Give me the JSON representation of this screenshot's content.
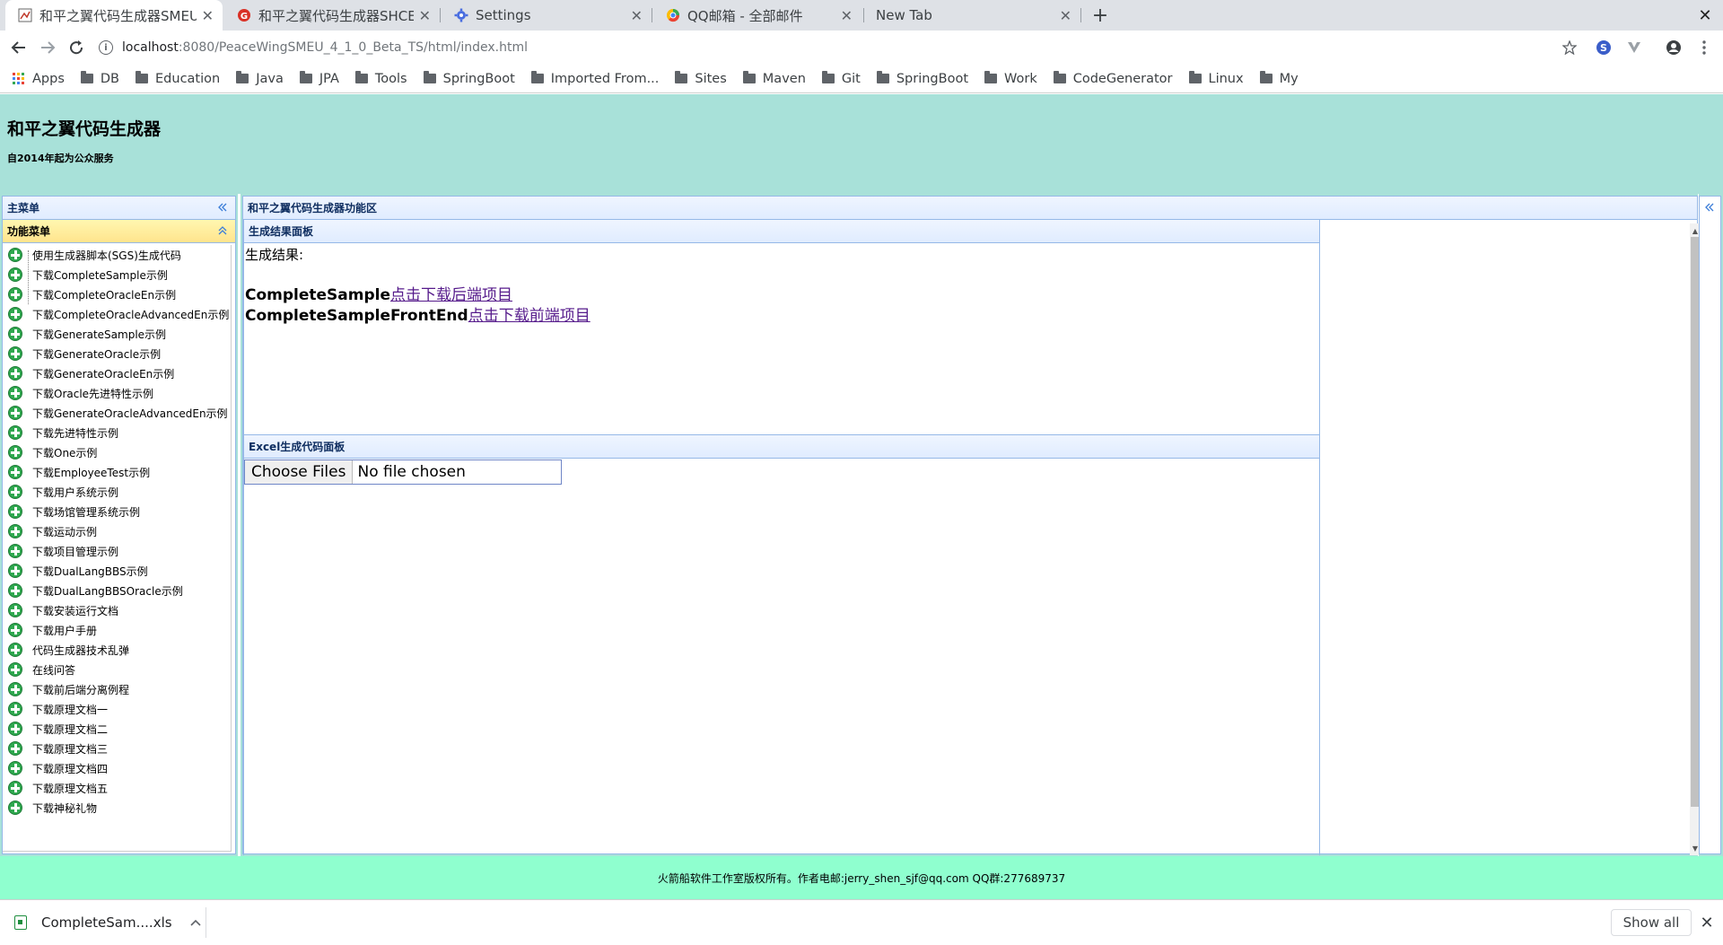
{
  "browser": {
    "tabs": [
      {
        "title": "和平之翼代码生成器SMEU",
        "active": true
      },
      {
        "title": "和平之翼代码生成器SHCE",
        "active": false
      },
      {
        "title": "Settings",
        "active": false
      },
      {
        "title": "QQ邮箱 - 全部邮件",
        "active": false
      },
      {
        "title": "New Tab",
        "active": false
      }
    ],
    "new_tab_label": "+",
    "close_label": "✕",
    "address": {
      "host": "localhost",
      "path": ":8080/PeaceWingSMEU_4_1_0_Beta_TS/html/index.html"
    },
    "bookmarks": [
      "Apps",
      "DB",
      "Education",
      "Java",
      "JPA",
      "Tools",
      "SpringBoot",
      "Imported From...",
      "Sites",
      "Maven",
      "Git",
      "SpringBoot",
      "Work",
      "CodeGenerator",
      "Linux",
      "My"
    ]
  },
  "header": {
    "title": "和平之翼代码生成器",
    "subtitle": "自2014年起为公众服务"
  },
  "west": {
    "title": "主菜单",
    "function_menu_title": "功能菜单",
    "items": [
      "使用生成器脚本(SGS)生成代码",
      "下载CompleteSample示例",
      "下载CompleteOracleEn示例",
      "下载CompleteOracleAdvancedEn示例",
      "下载GenerateSample示例",
      "下载GenerateOracle示例",
      "下载GenerateOracleEn示例",
      "下载Oracle先进特性示例",
      "下载GenerateOracleAdvancedEn示例",
      "下载先进特性示例",
      "下载One示例",
      "下载EmployeeTest示例",
      "下载用户系统示例",
      "下载场馆管理系统示例",
      "下载运动示例",
      "下载项目管理示例",
      "下载DualLangBBS示例",
      "下载DualLangBBSOracle示例",
      "下载安装运行文档",
      "下载用户手册",
      "代码生成器技术乱弹",
      "在线问答",
      "下载前后端分离例程",
      "下载原理文档一",
      "下载原理文档二",
      "下载原理文档三",
      "下载原理文档四",
      "下载原理文档五",
      "下载神秘礼物"
    ]
  },
  "center": {
    "title": "和平之翼代码生成器功能区",
    "result_panel": {
      "title": "生成结果面板",
      "label": "生成结果:",
      "lines": [
        {
          "name": "CompleteSample",
          "link": "点击下载后端项目"
        },
        {
          "name": "CompleteSampleFrontEnd",
          "link": "点击下载前端项目"
        }
      ]
    },
    "excel_panel": {
      "title": "Excel生成代码面板",
      "choose_files": "Choose Files",
      "file_status": "No file chosen"
    }
  },
  "footer": {
    "text": "火箭船软件工作室版权所有。作者电邮:jerry_shen_sjf@qq.com QQ群:277689737"
  },
  "downloads": {
    "file_name": "CompleteSam....xls",
    "show_all": "Show all"
  },
  "colors": {
    "header_bg": "#a8e1d9",
    "footer_bg": "#8fffcf",
    "panel_border": "#95b8e7",
    "function_menu_bg": "#ffe48d",
    "plus_icon": "#2fa84f"
  }
}
